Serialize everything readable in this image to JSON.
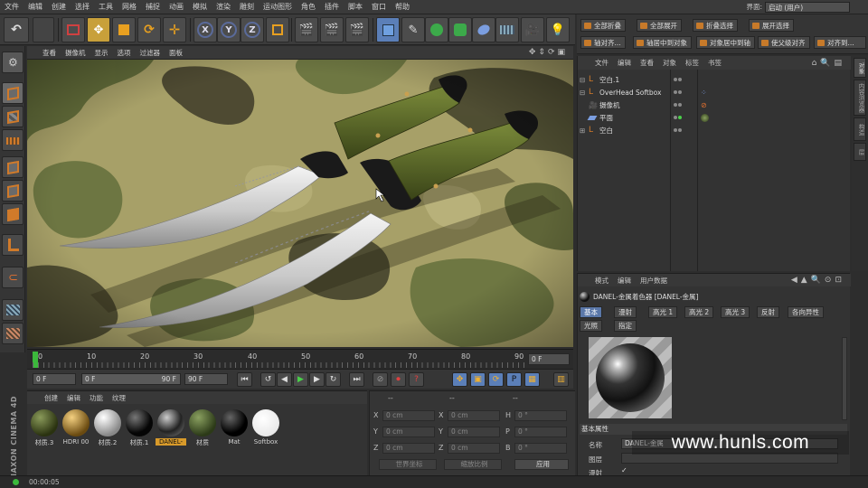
{
  "menu": [
    "文件",
    "编辑",
    "创建",
    "选择",
    "工具",
    "网格",
    "捕捉",
    "动画",
    "模拟",
    "渲染",
    "雕刻",
    "运动图形",
    "角色",
    "插件",
    "脚本",
    "窗口",
    "帮助"
  ],
  "layout": {
    "label": "界面:",
    "value": "启动 (用户)"
  },
  "toolbar": {
    "undo": "undo-icon",
    "x": "X",
    "y": "Y",
    "z": "Z"
  },
  "right_top": {
    "row1": [
      "全部折叠",
      "全部展开",
      "折叠选择",
      "展开选择"
    ],
    "row2": [
      "轴对齐...",
      "轴居中到对象",
      "对象居中到轴",
      "使父级对齐",
      "对齐到..."
    ]
  },
  "viewport_menu": [
    "查看",
    "摄像机",
    "显示",
    "选项",
    "过滤器",
    "面板"
  ],
  "timeline": {
    "ticks": [
      "0",
      "10",
      "20",
      "30",
      "40",
      "50",
      "60",
      "70",
      "80",
      "90"
    ],
    "current_frame": "0 F"
  },
  "playback": {
    "start": "0 F",
    "slider_start": "0 F",
    "slider_end": "90 F",
    "end": "90 F"
  },
  "material_manager": {
    "menu": [
      "创建",
      "编辑",
      "功能",
      "纹理"
    ],
    "materials": [
      {
        "label": "材质.3",
        "color": "#4a5a2a"
      },
      {
        "label": "HDRI 00",
        "color": "#b08a3a"
      },
      {
        "label": "材质.2",
        "color": "#b8b8b8"
      },
      {
        "label": "材质.1",
        "color": "#151515"
      },
      {
        "label": "DANEL-",
        "color": "#2a2a2a"
      },
      {
        "label": "材质",
        "color": "#4e6a3a"
      },
      {
        "label": "Mat",
        "color": "#101010"
      },
      {
        "label": "Softbox",
        "color": "#f4f4f4"
      }
    ]
  },
  "coordinates": {
    "header": [
      "--",
      "--",
      "--"
    ],
    "rows": [
      {
        "a": "X",
        "av": "0 cm",
        "b": "X",
        "bv": "0 cm",
        "c": "H",
        "cv": "0 °"
      },
      {
        "a": "Y",
        "av": "0 cm",
        "b": "Y",
        "bv": "0 cm",
        "c": "P",
        "cv": "0 °"
      },
      {
        "a": "Z",
        "av": "0 cm",
        "b": "Z",
        "bv": "0 cm",
        "c": "B",
        "cv": "0 °"
      }
    ],
    "mode1": "世界坐标",
    "mode2": "缩放比例",
    "apply": "应用"
  },
  "object_manager": {
    "menu": [
      "文件",
      "编辑",
      "查看",
      "对象",
      "标签",
      "书签"
    ],
    "objects": [
      {
        "name": "空白.1"
      },
      {
        "name": "OverHead Softbox"
      },
      {
        "name": "摄像机"
      },
      {
        "name": "平面"
      },
      {
        "name": "空白"
      }
    ]
  },
  "right_tabs": [
    "对象",
    "内容浏览器",
    "构造",
    "层"
  ],
  "attribute_manager": {
    "menu": [
      "模式",
      "编辑",
      "用户数据"
    ],
    "title": "DANEL-金属着色器 [DANEL-金属]",
    "tabs_row1": [
      "基本",
      "漫射",
      "高光 1",
      "高光 2",
      "高光 3",
      "反射",
      "各向异性"
    ],
    "tabs_row2": [
      "光照",
      "指定"
    ],
    "section": "基本属性",
    "fields": [
      {
        "label": "名称",
        "value": "DANEL-金属"
      },
      {
        "label": "图层",
        "value": ""
      },
      {
        "label": "漫射",
        "value": "✓"
      }
    ]
  },
  "status": {
    "time": "00:00:05"
  },
  "logo": {
    "cinema": "MAXON CINEMA 4D",
    "watermark": "www.hunls.com"
  }
}
